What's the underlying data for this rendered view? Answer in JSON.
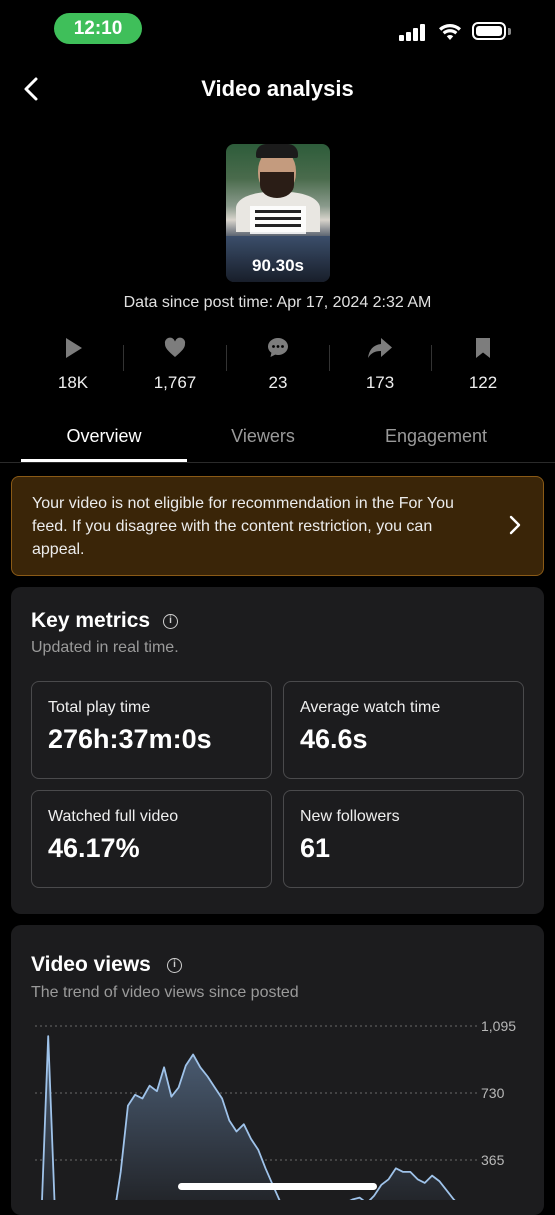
{
  "status_bar": {
    "time": "12:10"
  },
  "header": {
    "title": "Video analysis"
  },
  "video": {
    "duration": "90.30s",
    "data_since": "Data since post time: Apr 17, 2024 2:32 AM"
  },
  "stats": [
    {
      "icon": "play-icon",
      "value": "18K"
    },
    {
      "icon": "heart-icon",
      "value": "1,767"
    },
    {
      "icon": "comment-icon",
      "value": "23"
    },
    {
      "icon": "share-icon",
      "value": "173"
    },
    {
      "icon": "bookmark-icon",
      "value": "122"
    }
  ],
  "tabs": [
    {
      "label": "Overview",
      "active": true
    },
    {
      "label": "Viewers",
      "active": false
    },
    {
      "label": "Engagement",
      "active": false
    }
  ],
  "notice": {
    "text": "Your video is not eligible for recommendation in the For You feed. If you disagree with the content restriction, you can appeal."
  },
  "key_metrics": {
    "title": "Key metrics",
    "subtitle": "Updated in real time.",
    "items": [
      {
        "label": "Total play time",
        "value": "276h:37m:0s"
      },
      {
        "label": "Average watch time",
        "value": "46.6s"
      },
      {
        "label": "Watched full video",
        "value": "46.17%"
      },
      {
        "label": "New followers",
        "value": "61"
      }
    ]
  },
  "video_views": {
    "title": "Video views",
    "subtitle": "The trend of video views since posted"
  },
  "chart_data": {
    "type": "area",
    "y_ticks": [
      "1,095",
      "730",
      "365"
    ],
    "ylim": [
      0,
      1095
    ],
    "values": [
      0,
      1040,
      0,
      0,
      0,
      0,
      0,
      0,
      0,
      0,
      40,
      300,
      660,
      720,
      700,
      770,
      740,
      870,
      710,
      760,
      880,
      940,
      870,
      820,
      760,
      700,
      580,
      520,
      560,
      480,
      420,
      320,
      230,
      140,
      110,
      100,
      80,
      90,
      60,
      70,
      80,
      100,
      130,
      150,
      160,
      130,
      170,
      230,
      260,
      320,
      300,
      300,
      260,
      240,
      280,
      250,
      200,
      150,
      110,
      100
    ],
    "colors": {
      "line": "#9fc3ea",
      "fill_top": "#4e6179",
      "fill_bottom": "#1c1c1e"
    }
  }
}
